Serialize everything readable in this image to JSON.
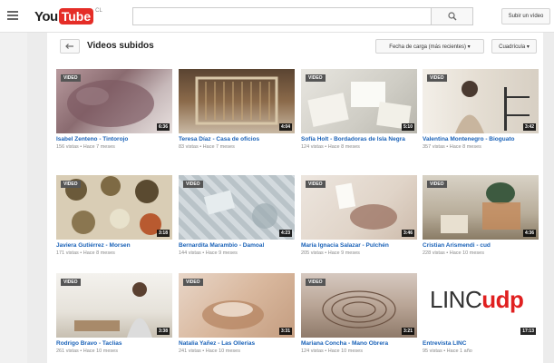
{
  "header": {
    "logo_you": "You",
    "logo_tube": "Tube",
    "logo_country": "CL",
    "search_placeholder": "",
    "upload_label": "Subir un vídeo"
  },
  "section": {
    "title": "Videos subidos",
    "sort_label": "Fecha de carga (más recientes) ▾",
    "view_label": "Cuadrícula ▾"
  },
  "videos": [
    {
      "title": "Isabel Zenteno - Tintorojo",
      "meta": "156 vistas • Hace 7 meses",
      "duration": "6:36",
      "tag": "VIDEO"
    },
    {
      "title": "Teresa Díaz - Casa de oficios",
      "meta": "83 vistas • Hace 7 meses",
      "duration": "4:04",
      "tag": ""
    },
    {
      "title": "Sofía Holt - Bordadoras de Isla Negra",
      "meta": "124 vistas • Hace 8 meses",
      "duration": "5:10",
      "tag": "VIDEO"
    },
    {
      "title": "Valentina Montenegro - Bioguato",
      "meta": "357 vistas • Hace 8 meses",
      "duration": "3:42",
      "tag": "VIDEO"
    },
    {
      "title": "Javiera Gutiérrez - Morsen",
      "meta": "171 vistas • Hace 8 meses",
      "duration": "3:18",
      "tag": "VIDEO"
    },
    {
      "title": "Bernardita Marambio - Damoal",
      "meta": "144 vistas • Hace 9 meses",
      "duration": "4:23",
      "tag": "VIDEO"
    },
    {
      "title": "María Ignacia Salazar - Pulchén",
      "meta": "205 vistas • Hace 9 meses",
      "duration": "3:46",
      "tag": "VIDEO"
    },
    {
      "title": "Cristian Arismendi - cud",
      "meta": "228 vistas • Hace 10 meses",
      "duration": "4:36",
      "tag": "VIDEO"
    },
    {
      "title": "Rodrigo Bravo - Taclias",
      "meta": "261 vistas • Hace 10 meses",
      "duration": "3:38",
      "tag": "VIDEO"
    },
    {
      "title": "Natalia Yañez - Las Ollerías",
      "meta": "241 vistas • Hace 10 meses",
      "duration": "3:31",
      "tag": "VIDEO"
    },
    {
      "title": "Mariana Concha - Mano Obrera",
      "meta": "124 vistas • Hace 10 meses",
      "duration": "3:21",
      "tag": "VIDEO"
    },
    {
      "title": "Entrevista LINC",
      "meta": "95 vistas • Hace 1 año",
      "duration": "17:13",
      "tag": "",
      "logo_part1": "LINC",
      "logo_part2": "udp"
    }
  ]
}
